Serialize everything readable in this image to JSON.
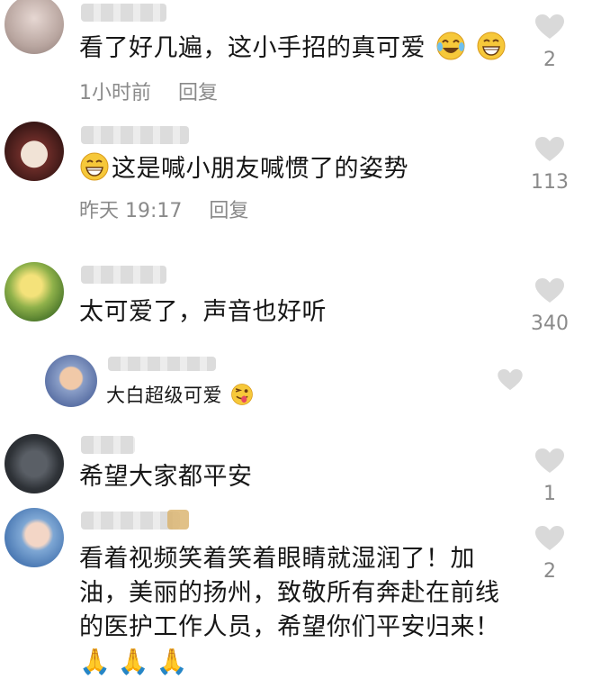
{
  "comments": [
    {
      "text": "看了好几遍，这小手招的真可爱",
      "time": "1小时前",
      "reply": "回复",
      "likes": "2",
      "emoji_icons": [
        "laughing-crying-emoji-icon",
        "grinning-emoji-icon"
      ]
    },
    {
      "text": "这是喊小朋友喊惯了的姿势",
      "time": "昨天 19:17",
      "reply": "回复",
      "likes": "113",
      "emoji_icons": [
        "grinning-emoji-icon"
      ]
    },
    {
      "text": "太可爱了，声音也好听",
      "likes": "340"
    },
    {
      "text": "大白超级可爱",
      "is_reply": true,
      "emoji_icons": [
        "winking-tongue-emoji-icon"
      ]
    },
    {
      "text": "希望大家都平安",
      "likes": "1"
    },
    {
      "lines": [
        "看着视频笑着笑着眼睛就湿润了！加",
        "油，美丽的扬州，致敬所有奔赴在前线",
        "的医护工作人员，希望你们平安归来！"
      ],
      "likes": "2",
      "emoji_icons": [
        "folded-hands-emoji-icon",
        "folded-hands-emoji-icon",
        "folded-hands-emoji-icon"
      ]
    }
  ],
  "colors": {
    "text": "#161616",
    "meta": "#8a8a8a",
    "heart": "#d9d9d9"
  }
}
